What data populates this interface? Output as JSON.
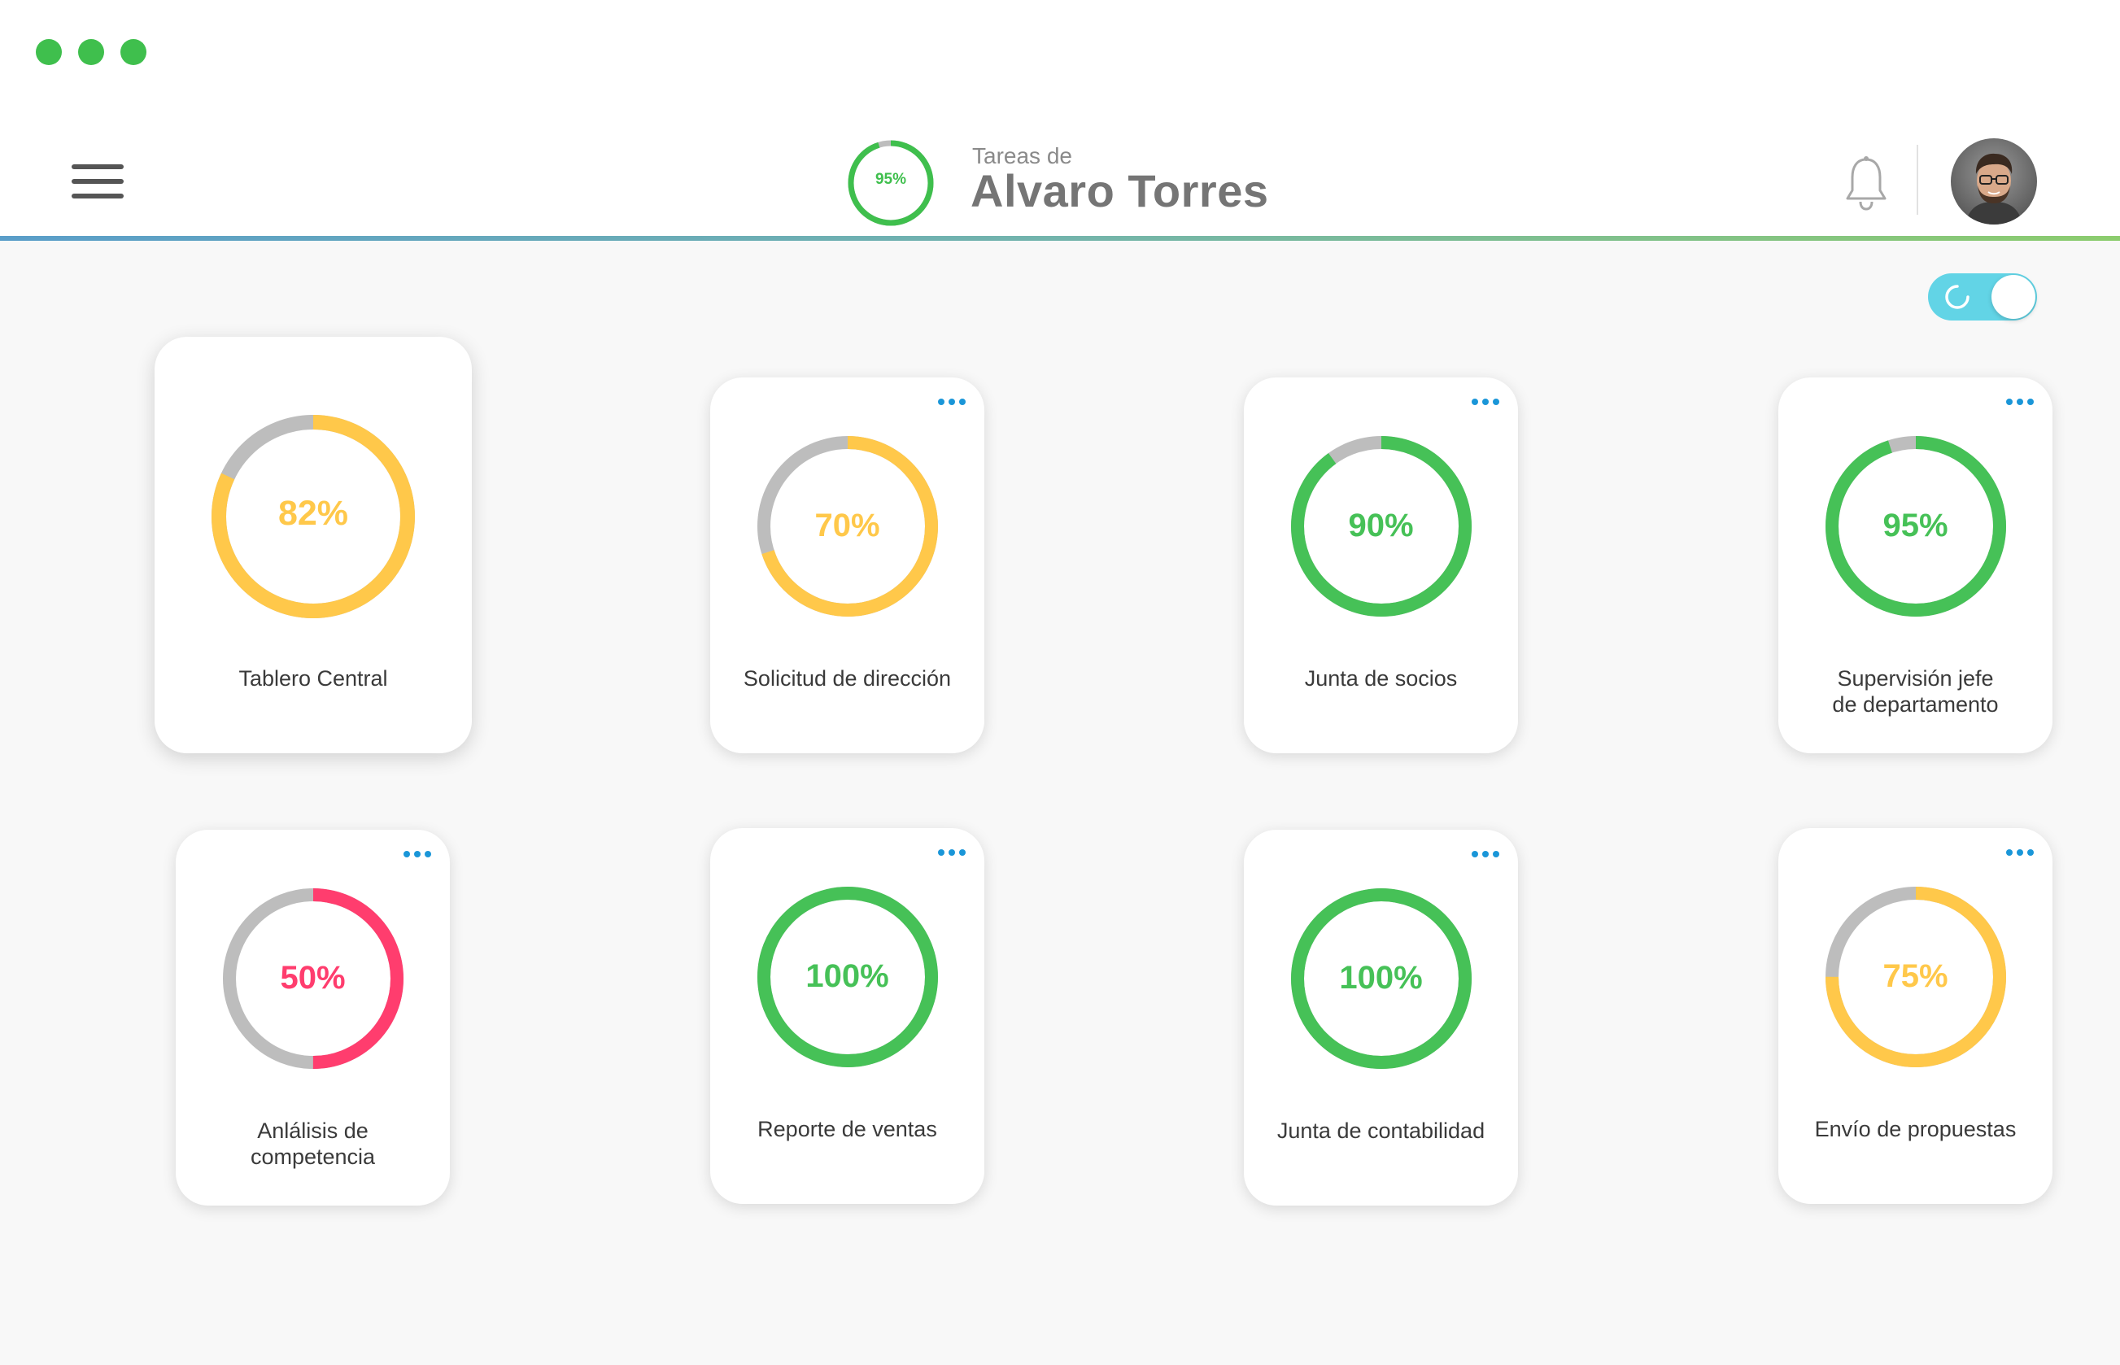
{
  "window": {
    "dots": [
      "#3fbf4d",
      "#3fbf4d",
      "#3fbf4d"
    ]
  },
  "header": {
    "subtitle": "Tareas de",
    "name": "Alvaro Torres",
    "overall_progress": 95,
    "overall_label": "95%",
    "overall_color": "#3fbf4d",
    "menu_icon": "hamburger-menu-icon",
    "notification_icon": "bell-icon",
    "avatar_icon": "user-avatar"
  },
  "toggle": {
    "state": "on",
    "color": "#62d4e6",
    "icon": "refresh-icon"
  },
  "colors": {
    "yellow": "#ffc84a",
    "green": "#46c157",
    "red": "#ff3d6e",
    "track": "#bdbdbd",
    "accent_blue": "#1a96d8"
  },
  "tasks": [
    {
      "label": "Tablero Central",
      "percent": 82,
      "percent_label": "82%",
      "color": "#ffc84a",
      "has_menu": false
    },
    {
      "label": "Solicitud de dirección",
      "percent": 70,
      "percent_label": "70%",
      "color": "#ffc84a",
      "has_menu": true
    },
    {
      "label": "Junta de socios",
      "percent": 90,
      "percent_label": "90%",
      "color": "#46c157",
      "has_menu": true
    },
    {
      "label": "Supervisión jefe\nde departamento",
      "percent": 95,
      "percent_label": "95%",
      "color": "#46c157",
      "has_menu": true
    },
    {
      "label": "Anlálisis de\ncompetencia",
      "percent": 50,
      "percent_label": "50%",
      "color": "#ff3d6e",
      "has_menu": true
    },
    {
      "label": "Reporte de ventas",
      "percent": 100,
      "percent_label": "100%",
      "color": "#46c157",
      "has_menu": true
    },
    {
      "label": "Junta de contabilidad",
      "percent": 100,
      "percent_label": "100%",
      "color": "#46c157",
      "has_menu": true
    },
    {
      "label": "Envío de propuestas",
      "percent": 75,
      "percent_label": "75%",
      "color": "#ffc84a",
      "has_menu": true
    }
  ]
}
